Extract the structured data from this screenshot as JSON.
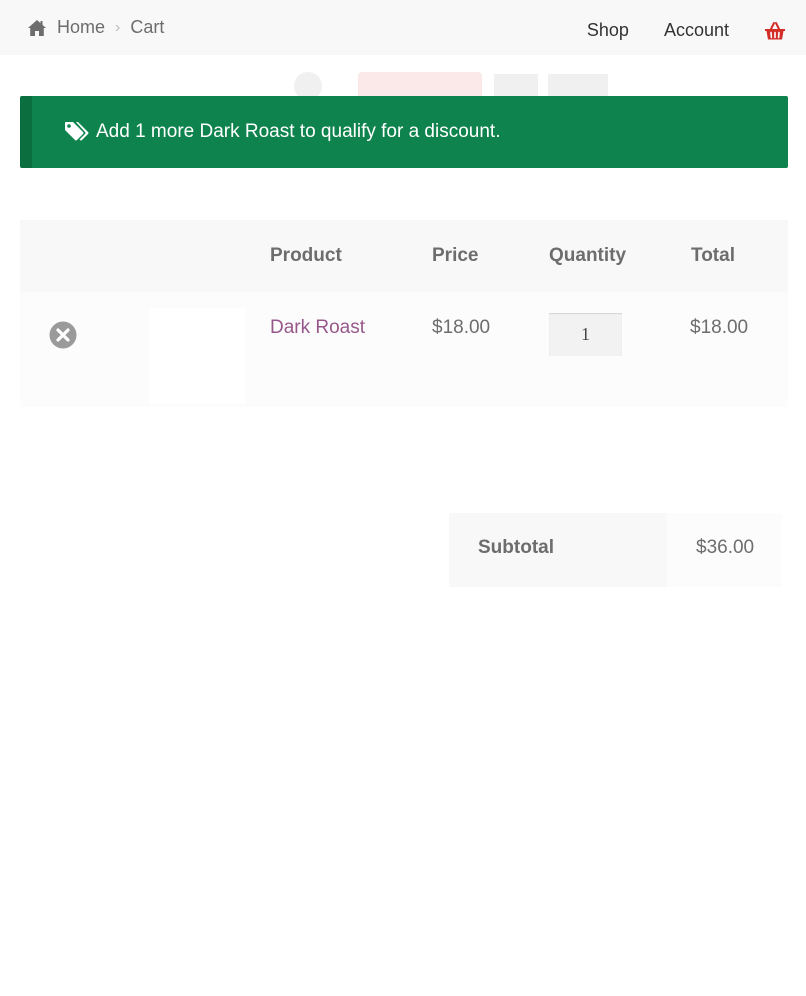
{
  "breadcrumb": {
    "home": "Home",
    "current": "Cart"
  },
  "nav": {
    "shop": "Shop",
    "account": "Account"
  },
  "notice": {
    "text": "Add 1 more Dark Roast to qualify for a discount."
  },
  "cart": {
    "headers": {
      "product": "Product",
      "price": "Price",
      "quantity": "Quantity",
      "total": "Total"
    },
    "items": [
      {
        "name": "Dark Roast",
        "price": "$18.00",
        "quantity": "1",
        "total": "$18.00"
      }
    ]
  },
  "totals": {
    "subtotal_label": "Subtotal",
    "subtotal_value": "$36.00"
  },
  "colors": {
    "notice_bg": "#0f834d",
    "product_link": "#96588a",
    "basket": "#d22d27"
  },
  "icons": {
    "home": "home-icon",
    "chevron": "chevron-right-icon",
    "basket": "basket-icon",
    "tag": "tags-icon",
    "remove": "remove-icon"
  }
}
